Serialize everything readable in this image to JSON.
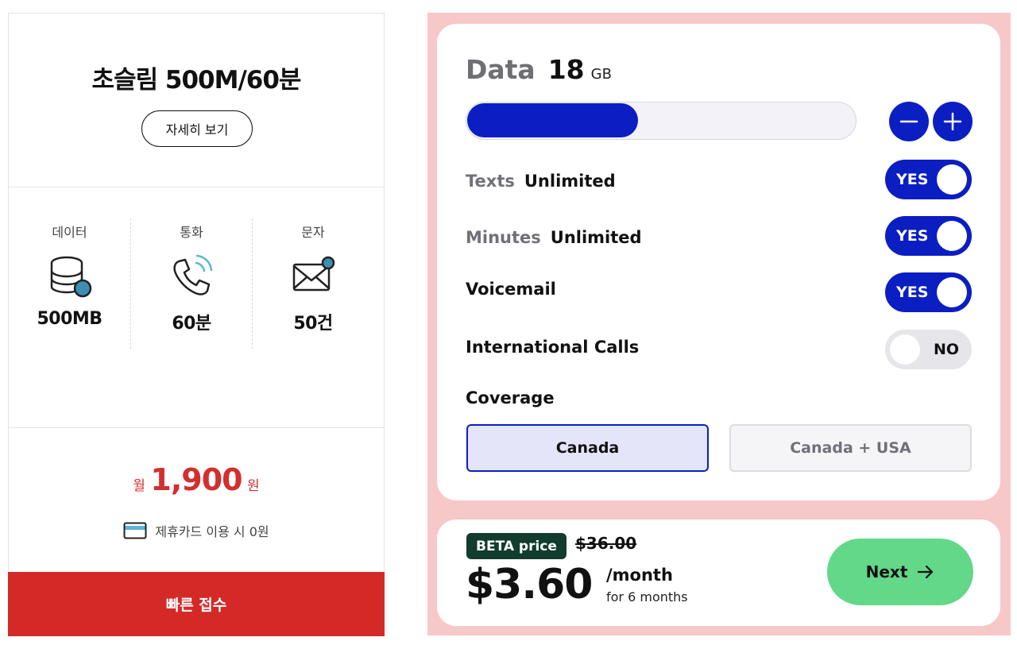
{
  "plan": {
    "title": "초슬림 500M/60분",
    "detail_button": "자세히 보기",
    "features": [
      {
        "label": "데이터",
        "value": "500MB",
        "icon": "database-icon"
      },
      {
        "label": "통화",
        "value": "60분",
        "icon": "phone-icon"
      },
      {
        "label": "문자",
        "value": "50건",
        "icon": "envelope-icon"
      }
    ],
    "price": {
      "prefix": "월",
      "amount": "1,900",
      "suffix": "원"
    },
    "card_note": "제휴카드 이용 시 0원",
    "quick_apply": "빠른 접수"
  },
  "config": {
    "data": {
      "label": "Data",
      "value": "18",
      "unit": "GB",
      "slider_fraction": 0.44
    },
    "options": [
      {
        "label": "Texts",
        "value": "Unlimited",
        "toggle": "YES",
        "on": true
      },
      {
        "label": "Minutes",
        "value": "Unlimited",
        "toggle": "YES",
        "on": true
      },
      {
        "label": "Voicemail",
        "value": "",
        "toggle": "YES",
        "on": true
      },
      {
        "label": "International Calls",
        "value": "",
        "toggle": "NO",
        "on": false
      }
    ],
    "coverage": {
      "label": "Coverage",
      "options": [
        "Canada",
        "Canada + USA"
      ],
      "selected": "Canada"
    }
  },
  "pricing": {
    "badge": "BETA price",
    "old_price": "$36.00",
    "price": "$3.60",
    "per": "/month",
    "duration": "for 6 months",
    "next": "Next"
  },
  "colors": {
    "brand_red": "#d32a28",
    "accent_blue": "#0a1ec2",
    "panel_pink": "#f7c8c8",
    "next_green": "#62d888",
    "badge_green": "#123c2e"
  }
}
